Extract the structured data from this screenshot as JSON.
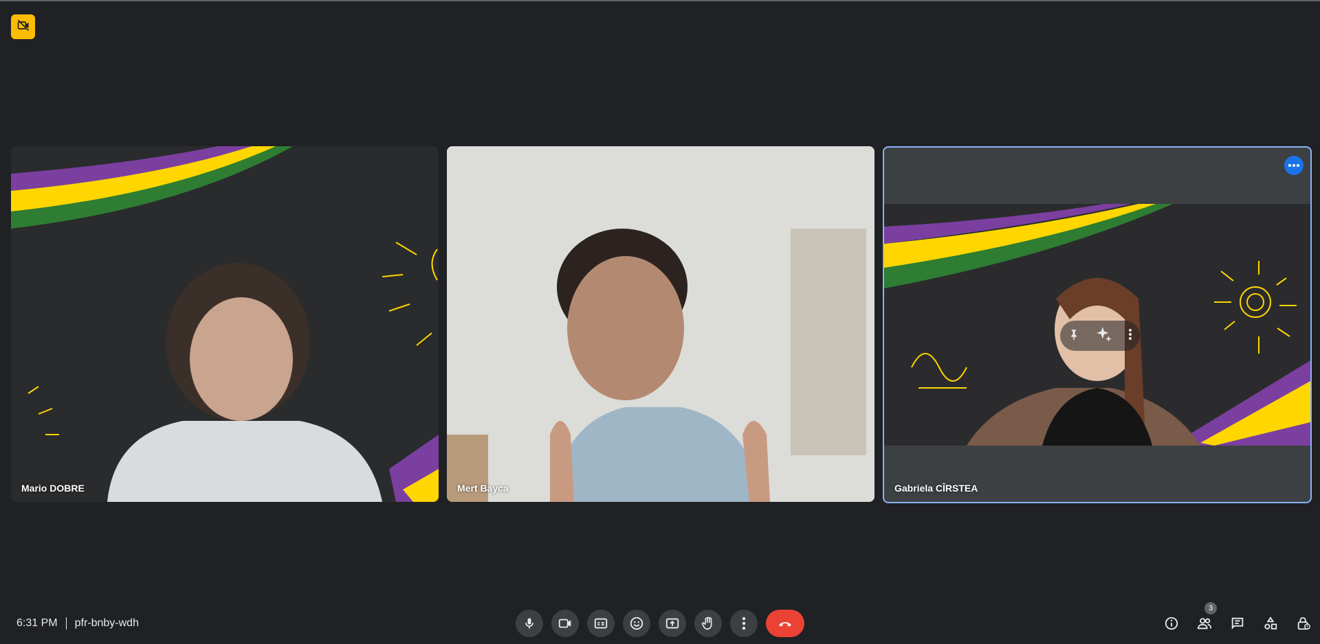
{
  "meeting": {
    "time": "6:31 PM",
    "code": "pfr-bnby-wdh"
  },
  "participants": [
    {
      "name": "Mario DOBRE"
    },
    {
      "name": "Mert Bayca"
    },
    {
      "name": "Gabriela CÎRSTEA"
    }
  ],
  "participant_count": "3",
  "colors": {
    "background": "#202124",
    "control": "#3c4043",
    "end_call": "#ea4335",
    "active_outline": "#8ab4f8",
    "badge": "#fbbc04",
    "accent_blue": "#1a73e8",
    "ribbon_purple": "#7b3fa0",
    "ribbon_yellow": "#ffd600",
    "ribbon_green": "#2e7d32"
  },
  "icons": {
    "top_badge": "video-off-icon",
    "controls": [
      "mic-icon",
      "camera-icon",
      "captions-icon",
      "emoji-icon",
      "present-icon",
      "raise-hand-icon",
      "more-options-icon",
      "end-call-icon"
    ],
    "right": [
      "info-icon",
      "people-icon",
      "chat-icon",
      "activities-icon",
      "host-controls-icon"
    ]
  }
}
